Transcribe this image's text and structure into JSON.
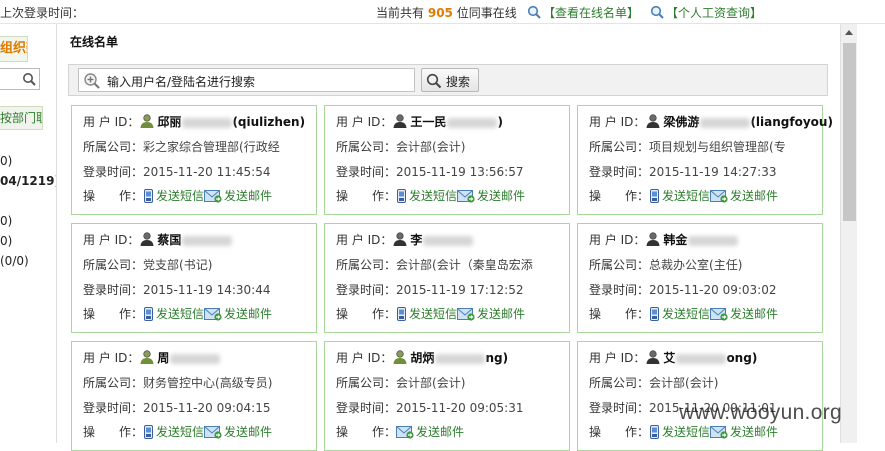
{
  "topbar": {
    "last_login_label": "上次登录时间：",
    "online_prefix": "当前共有",
    "online_count": "905",
    "online_suffix": "位同事在线",
    "view_online_link": "【查看在线名单】",
    "salary_query_link": "【个人工资查询】"
  },
  "sidebar": {
    "org_tab": "组织架构",
    "dept_tab": "按部门职能",
    "counts": [
      "0)",
      "04/1219)",
      "0)",
      "0)",
      "(0/0)"
    ]
  },
  "main": {
    "title": "在线名单",
    "search_placeholder": "输入用户名/登陆名进行搜索",
    "search_button": "搜索"
  },
  "labels": {
    "user_id": "用 户 ID：",
    "company": "所属公司：",
    "login_time": "登录时间：",
    "operation": "操　　作：",
    "send_sms": "发送短信",
    "send_email": "发送邮件"
  },
  "users": [
    {
      "name_start": "邱丽",
      "name_end": "(qiulizhen)",
      "company": "彩之家综合管理部(行政经",
      "login_time": "2015-11-20 11:45:54",
      "has_sms": true
    },
    {
      "name_start": "王一民",
      "name_end": ")",
      "company": "会计部(会计)",
      "login_time": "2015-11-19 13:56:57",
      "has_sms": true
    },
    {
      "name_start": "梁佛游",
      "name_end": "(liangfoyou)",
      "company": "项目规划与组织管理部(专",
      "login_time": "2015-11-19 14:27:33",
      "has_sms": true
    },
    {
      "name_start": "蔡国",
      "name_end": "",
      "company": "党支部(书记)",
      "login_time": "2015-11-19 14:30:44",
      "has_sms": true
    },
    {
      "name_start": "李",
      "name_end": "",
      "company": "会计部(会计（秦皇岛宏添",
      "login_time": "2015-11-19 17:12:52",
      "has_sms": true
    },
    {
      "name_start": "韩金",
      "name_end": "",
      "company": "总裁办公室(主任)",
      "login_time": "2015-11-20 09:03:02",
      "has_sms": true
    },
    {
      "name_start": "周",
      "name_end": "",
      "company": "财务管控中心(高级专员)",
      "login_time": "2015-11-20 09:04:15",
      "has_sms": true
    },
    {
      "name_start": "胡炳",
      "name_end": "ng)",
      "company": "会计部(会计)",
      "login_time": "2015-11-20 09:05:31",
      "has_sms": false
    },
    {
      "name_start": "艾",
      "name_end": "ong)",
      "company": "会计部(会计)",
      "login_time": "2015-11-20 09:11:01",
      "has_sms": true
    }
  ],
  "watermark": "www.wooyun.org",
  "colors": {
    "accent_orange": "#e07b00",
    "link_green": "#2e7d2e",
    "card_border": "#a8d89a"
  }
}
